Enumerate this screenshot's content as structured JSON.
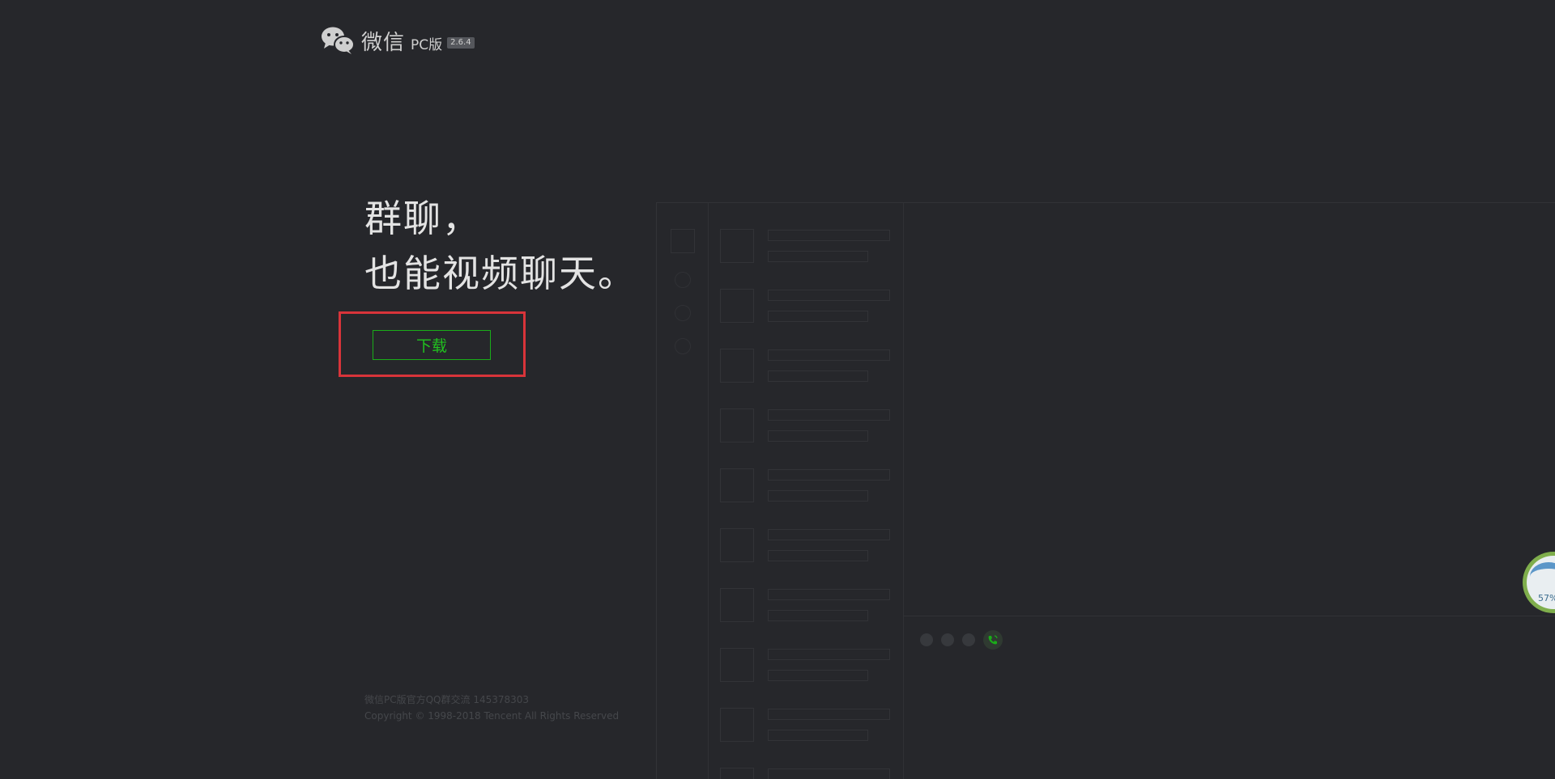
{
  "header": {
    "brand_name": "微信",
    "brand_suffix": "PC版",
    "version": "2.6.4",
    "logo_icon": "wechat-logo-icon"
  },
  "hero": {
    "headline_line1": "群聊，",
    "headline_line2": "也能视频聊天。",
    "download_label": "下载"
  },
  "footer": {
    "qq_group": "微信PC版官方QQ群交流 145378303",
    "copyright": "Copyright © 1998-2018 Tencent All Rights Reserved"
  },
  "badge": {
    "percent_text": "57%"
  },
  "colors": {
    "background": "#26272b",
    "accent_green": "#1aad19",
    "highlight_red": "#d8343a"
  }
}
